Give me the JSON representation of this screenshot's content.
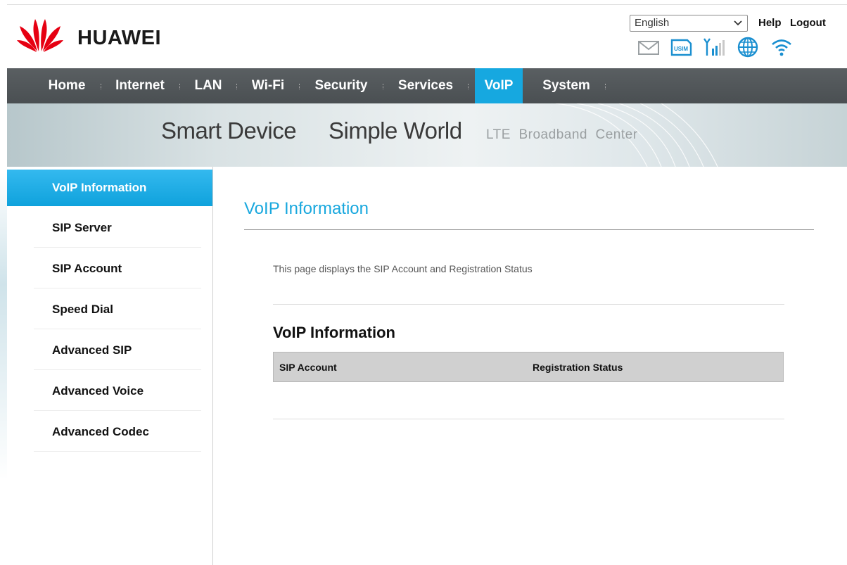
{
  "header": {
    "brand": "HUAWEI",
    "language": "English",
    "help_label": "Help",
    "logout_label": "Logout",
    "status_icons": [
      "mail-icon",
      "usim-icon",
      "signal-icon",
      "internet-globe-icon",
      "wifi-icon"
    ],
    "usim_text": "USIM"
  },
  "nav": {
    "items": [
      "Home",
      "Internet",
      "LAN",
      "Wi-Fi",
      "Security",
      "Services",
      "VoIP",
      "System"
    ],
    "active": "VoIP"
  },
  "banner": {
    "slogan1": "Smart Device",
    "slogan2": "Simple World",
    "tagline": "LTE  Broadband  Center"
  },
  "sidebar": {
    "items": [
      "VoIP Information",
      "SIP Server",
      "SIP Account",
      "Speed Dial",
      "Advanced SIP",
      "Advanced Voice",
      "Advanced Codec"
    ],
    "active": "VoIP Information"
  },
  "main": {
    "title": "VoIP Information",
    "description": "This page displays the SIP Account and Registration Status",
    "section_title": "VoIP Information",
    "table_headers": [
      "SIP Account",
      "Registration Status"
    ]
  },
  "colors": {
    "accent": "#16a8e0",
    "nav_bg": "#4e5356",
    "table_header_bg": "#d0d0d0",
    "brand_red": "#e60012"
  }
}
